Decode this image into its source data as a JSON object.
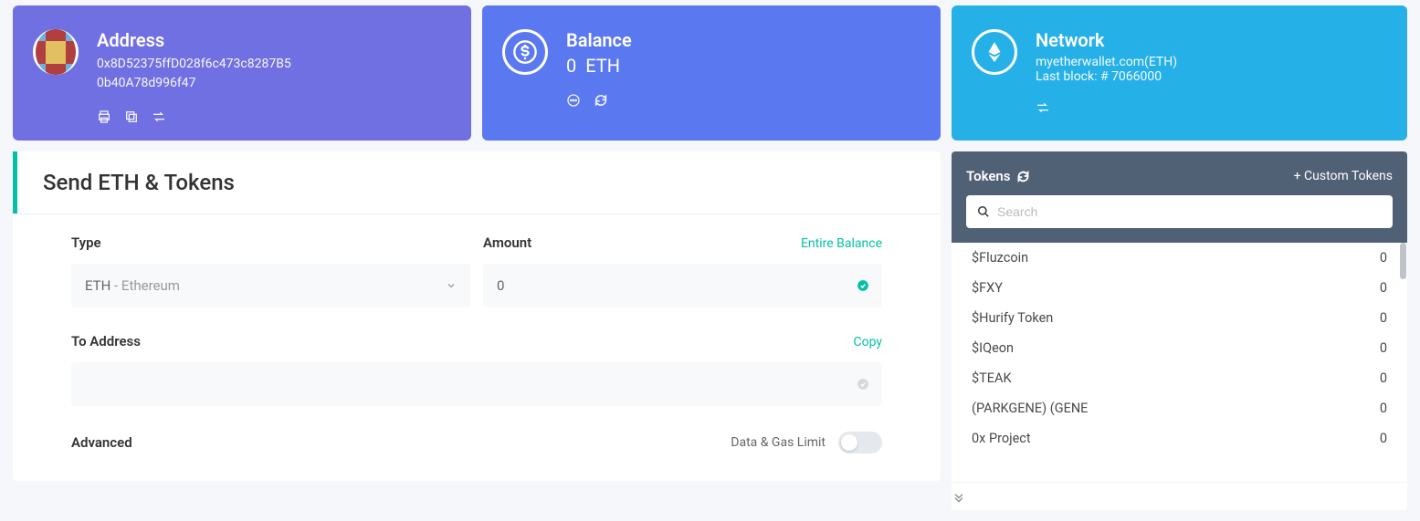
{
  "cards": {
    "address": {
      "title": "Address",
      "line1": "0x8D52375ffD028f6c473c8287B5",
      "line2": "0b40A78d996f47"
    },
    "balance": {
      "title": "Balance",
      "value": "0",
      "symbol": "ETH"
    },
    "network": {
      "title": "Network",
      "line1": "myetherwallet.com(ETH)",
      "line2": "Last block: # 7066000"
    }
  },
  "send": {
    "title": "Send ETH & Tokens",
    "type_label": "Type",
    "type_value_main": "ETH",
    "type_value_sub": " - Ethereum",
    "amount_label": "Amount",
    "entire_balance": "Entire Balance",
    "amount_value": "0",
    "to_label": "To Address",
    "copy": "Copy",
    "to_value": "",
    "advanced_label": "Advanced",
    "gas_label": "Data & Gas Limit"
  },
  "tokens": {
    "title": "Tokens",
    "custom": "+ Custom Tokens",
    "search_placeholder": "Search",
    "list": [
      {
        "name": "$Fluzcoin",
        "amount": "0"
      },
      {
        "name": "$FXY",
        "amount": "0"
      },
      {
        "name": "$Hurify Token",
        "amount": "0"
      },
      {
        "name": "$IQeon",
        "amount": "0"
      },
      {
        "name": "$TEAK",
        "amount": "0"
      },
      {
        "name": "(PARKGENE) (GENE",
        "amount": "0"
      },
      {
        "name": "0x Project",
        "amount": "0"
      }
    ]
  }
}
